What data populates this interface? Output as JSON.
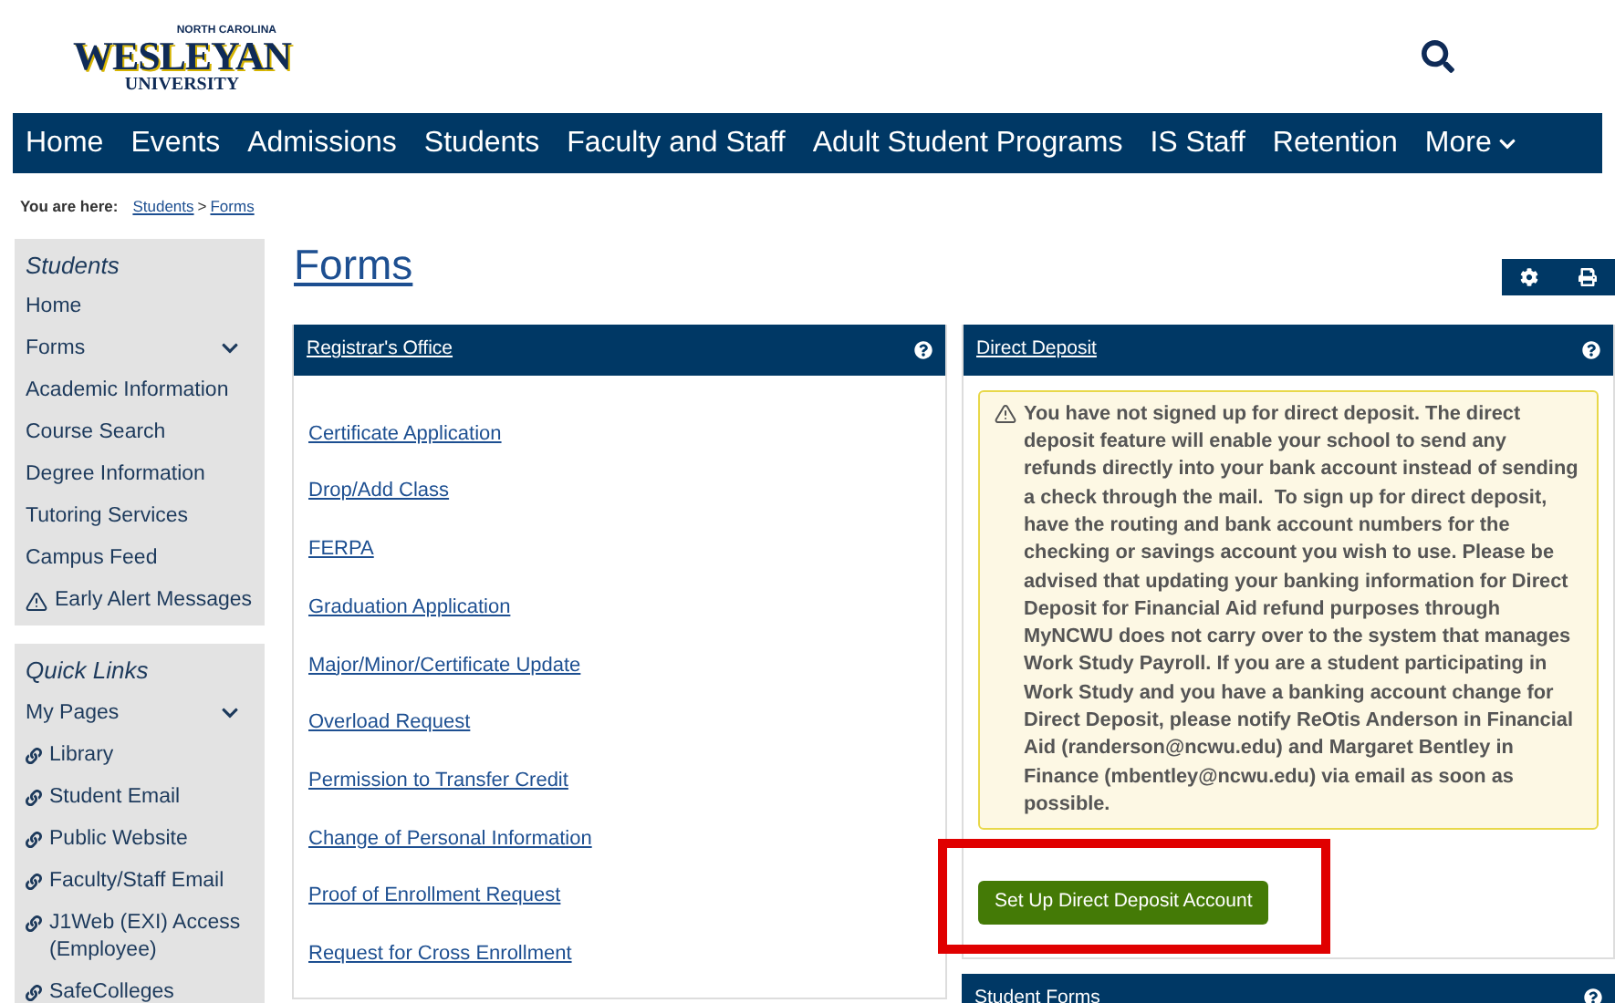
{
  "header": {
    "logo": {
      "top": "NORTH CAROLINA",
      "main": "WESLEYAN",
      "bottom": "UNIVERSITY"
    }
  },
  "nav": [
    {
      "label": "Home",
      "dropdown": false
    },
    {
      "label": "Events",
      "dropdown": false
    },
    {
      "label": "Admissions",
      "dropdown": false
    },
    {
      "label": "Students",
      "dropdown": false
    },
    {
      "label": "Faculty and Staff",
      "dropdown": false
    },
    {
      "label": "Adult Student Programs",
      "dropdown": false
    },
    {
      "label": "IS Staff",
      "dropdown": false
    },
    {
      "label": "Retention",
      "dropdown": false
    },
    {
      "label": "More",
      "dropdown": true
    }
  ],
  "breadcrumb": {
    "label": "You are here:",
    "links": [
      "Students",
      "Forms"
    ],
    "separator": ">"
  },
  "sidebar": [
    {
      "title": "Students",
      "items": [
        {
          "label": "Home",
          "kind": "link"
        },
        {
          "label": "Forms",
          "kind": "dropdown"
        },
        {
          "label": "Academic Information",
          "kind": "link"
        },
        {
          "label": "Course Search",
          "kind": "link"
        },
        {
          "label": "Degree Information",
          "kind": "link"
        },
        {
          "label": "Tutoring Services",
          "kind": "link"
        },
        {
          "label": "Campus Feed",
          "kind": "link"
        },
        {
          "label": "Early Alert Messages",
          "kind": "alert"
        }
      ]
    },
    {
      "title": "Quick Links",
      "items": [
        {
          "label": "My Pages",
          "kind": "dropdown"
        },
        {
          "label": "Library",
          "kind": "external"
        },
        {
          "label": "Student Email",
          "kind": "external"
        },
        {
          "label": "Public Website",
          "kind": "external"
        },
        {
          "label": "Faculty/Staff Email",
          "kind": "external"
        },
        {
          "label": "J1Web (EXI) Access (Employee)",
          "kind": "external"
        },
        {
          "label": "SafeColleges",
          "kind": "external"
        }
      ]
    }
  ],
  "page_title": "Forms",
  "registrar": {
    "title": "Registrar's Office",
    "links": [
      "Certificate Application",
      "Drop/Add Class",
      "FERPA",
      "Graduation Application",
      "Major/Minor/Certificate Update",
      "Overload Request",
      "Permission to Transfer Credit",
      "Change of Personal Information",
      "Proof of Enrollment Request",
      "Request for Cross Enrollment"
    ]
  },
  "direct_deposit": {
    "title": "Direct Deposit",
    "alert": "You have not signed up for direct deposit. The direct deposit feature will enable your school to send any refunds directly into your bank account instead of sending a check through the mail.  To sign up for direct deposit, have the routing and bank account numbers for the checking or savings account you wish to use. Please be advised that updating your banking information for Direct Deposit for Financial Aid refund purposes through MyNCWU does not carry over to the system that manages Work Study Payroll. If you are a student participating in Work Study and you have a banking account change for Direct Deposit, please notify ReOtis Anderson in Financial Aid (randerson@ncwu.edu) and Margaret Bentley in Finance (mbentley@ncwu.edu) via email as soon as possible.",
    "button": "Set Up Direct Deposit Account"
  },
  "student_forms": {
    "title": "Student Forms"
  }
}
